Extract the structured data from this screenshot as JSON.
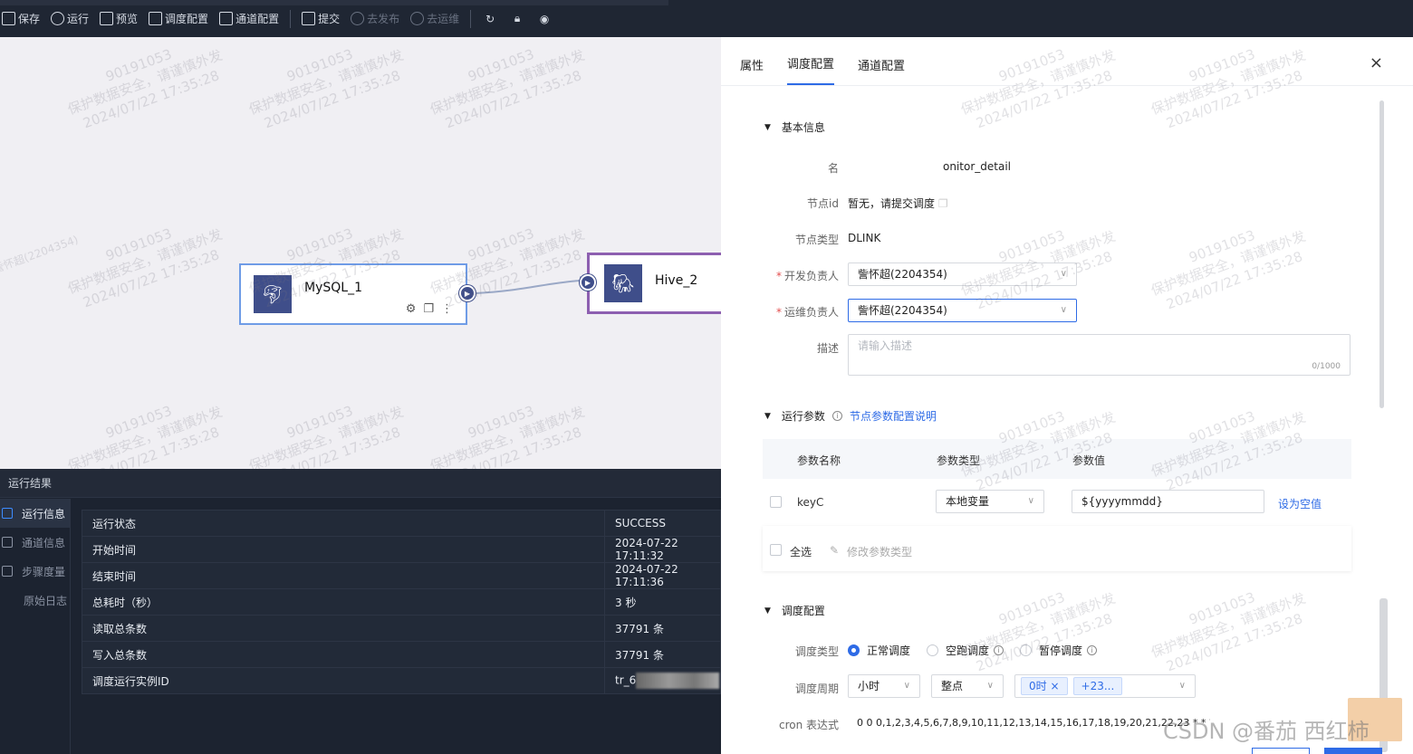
{
  "toolbar": {
    "save": "保存",
    "run": "运行",
    "preview": "预览",
    "schedule_config": "调度配置",
    "channel_config": "通道配置",
    "submit": "提交",
    "publish": "去发布",
    "ops": "去运维"
  },
  "canvas": {
    "nodes": [
      {
        "label": "MySQL_1",
        "icon": "dolphin-icon"
      },
      {
        "label": "Hive_2",
        "icon": "hive-icon"
      }
    ]
  },
  "watermark": {
    "line1": "90191053",
    "line2": "保护数据安全，请谨慎外发",
    "line3": "2024/07/22 17:35:28",
    "line4": "訾怀超(2204354)"
  },
  "results": {
    "title": "运行结果",
    "sidebar": [
      "运行信息",
      "通道信息",
      "步骤度量",
      "原始日志"
    ],
    "rows": [
      {
        "key": "运行状态",
        "value": "SUCCESS"
      },
      {
        "key": "开始时间",
        "value": "2024-07-22 17:11:32"
      },
      {
        "key": "结束时间",
        "value": "2024-07-22 17:11:36"
      },
      {
        "key": "总耗时（秒）",
        "value": "3 秒"
      },
      {
        "key": "读取总条数",
        "value": "37791 条"
      },
      {
        "key": "写入总条数",
        "value": "37791 条"
      },
      {
        "key": "调度运行实例ID",
        "value": "tr_6"
      }
    ]
  },
  "panel": {
    "tabs": [
      "属性",
      "调度配置",
      "通道配置"
    ],
    "close": "×",
    "basic": {
      "section": "基本信息",
      "name_label": "名",
      "name_value": "onitor_detail",
      "node_id_label": "节点id",
      "node_id_value": "暂无，请提交调度",
      "node_type_label": "节点类型",
      "node_type_value": "DLINK",
      "dev_owner_label": "开发负责人",
      "dev_owner_value": "訾怀超(2204354)",
      "ops_owner_label": "运维负责人",
      "ops_owner_value": "訾怀超(2204354)",
      "desc_label": "描述",
      "desc_placeholder": "请输入描述",
      "desc_counter": "0/1000"
    },
    "params": {
      "section": "运行参数",
      "help_link": "节点参数配置说明",
      "col_name": "参数名称",
      "col_type": "参数类型",
      "col_value": "参数值",
      "row_name": "keyC",
      "row_type": "本地变量",
      "row_value": "${yyyymmdd}",
      "row_action": "设为空值",
      "select_all": "全选",
      "modify_type": "修改参数类型"
    },
    "schedule": {
      "section": "调度配置",
      "type_label": "调度类型",
      "type_options": [
        "正常调度",
        "空跑调度",
        "暂停调度"
      ],
      "cycle_label": "调度周期",
      "cycle_value": "小时",
      "point_value": "整点",
      "tag1": "0时",
      "tag2": "+23...",
      "cron_label": "cron 表达式",
      "cron_value": "0 0 0,1,2,3,4,5,6,7,8,9,10,11,12,13,14,15,16,17,18,19,20,21,22,23 * * ?"
    }
  },
  "csdn": "CSDN @番茄 西红柿"
}
